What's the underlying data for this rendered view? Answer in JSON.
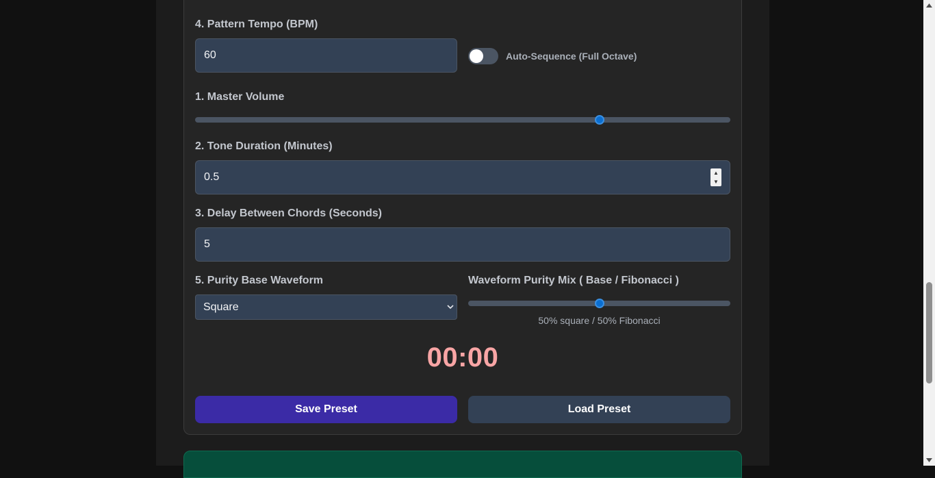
{
  "tempo": {
    "label": "4. Pattern Tempo (BPM)",
    "value": "60",
    "auto_sequence_label": "Auto-Sequence (Full Octave)",
    "auto_sequence_on": false
  },
  "volume": {
    "label": "1. Master Volume",
    "level": 0.76
  },
  "duration": {
    "label": "2. Tone Duration (Minutes)",
    "value": "0.5"
  },
  "delay": {
    "label": "3. Delay Between Chords (Seconds)",
    "value": "5"
  },
  "waveform": {
    "label": "5. Purity Base Waveform",
    "selected": "Square"
  },
  "mix": {
    "label": "Waveform Purity Mix ( Base / Fibonacci )",
    "level": 0.5,
    "caption": "50% square / 50% Fibonacci"
  },
  "timer": "00:00",
  "buttons": {
    "save": "Save Preset",
    "load": "Load Preset"
  },
  "colors": {
    "accent": "#0a6ed1",
    "save_button": "#3b2ba6",
    "timer": "#f8a5a5"
  }
}
